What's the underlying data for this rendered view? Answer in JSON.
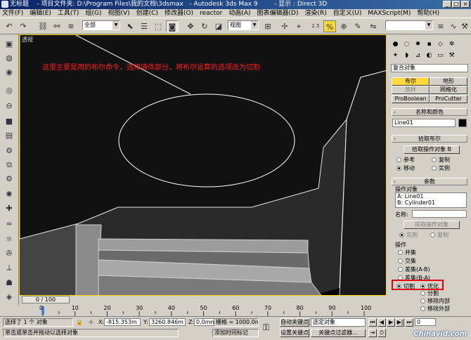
{
  "window": {
    "title_left": "无标题    - 项目文件夹: D:\\Program Files\\我的文档\\3dsmax   - Autodesk 3ds Max 9",
    "title_right": "- 显示 : Direct 3D"
  },
  "menu": [
    "文件(F)",
    "编辑(E)",
    "工具(T)",
    "组(G)",
    "视图(V)",
    "创建(C)",
    "修改器(O)",
    "reactor",
    "动画(A)",
    "图表编辑器(D)",
    "渲染(R)",
    "自定义(U)",
    "MAXScript(M)",
    "帮助(H)"
  ],
  "toolbar": {
    "selection_filter": "全部",
    "reference_coord": "视图",
    "named_selection": "",
    "angle_snap_label": "2.5"
  },
  "viewport": {
    "label": "透视",
    "annotation": "这里主要是用的布尔命令，选择墙体部分，将布尔运算的选项改为切割"
  },
  "command_panel": {
    "category": "复合对象",
    "buttons": {
      "boolean": "布尔",
      "shape_merge": "地形",
      "loft": "放样",
      "mesher": "网格化",
      "proboolean": "ProBoolean",
      "procutter": "ProCutter"
    },
    "name_color_header": "名称和颜色",
    "object_name": "Line01",
    "pick_boolean_header": "拾取布尔",
    "pick_operand_button": "拾取操作对象 B",
    "pick_options": {
      "reference": "参考",
      "copy": "复制",
      "move": "移动",
      "instance": "实例"
    },
    "params_header": "参数",
    "operands_label": "操作对象",
    "operands": [
      "A: Line01",
      "B: Cylinder01"
    ],
    "name_label": "名称:",
    "extract_button": "提取操作对象",
    "extract_options": {
      "instance": "实例",
      "copy": "复制"
    },
    "operation_label": "操作",
    "operations": {
      "union": "并集",
      "intersection": "交集",
      "sub_ab": "差集(A-B)",
      "sub_ba": "差集(B-A)",
      "cut": "切割",
      "refine": "优化",
      "split": "分割",
      "remove_inside": "移除内部",
      "remove_outside": "移除外部"
    }
  },
  "timeline": {
    "frame_display": "0 / 100",
    "ticks": [
      "0",
      "10",
      "20",
      "30",
      "40",
      "50",
      "60",
      "70",
      "80",
      "90",
      "100"
    ]
  },
  "status": {
    "selection": "选择了 1 个 对象",
    "prompt": "单击或单击并拖动以选择对象",
    "x_label": "X:",
    "x_value": "-815.353m",
    "y_label": "Y:",
    "y_value": "3260.846m",
    "z_label": "Z:",
    "z_value": "0.0mm",
    "grid": "栅格 = 1000.0mm",
    "add_time_tag": "添加时间标记",
    "auto_key": "自动关键点",
    "set_key": "设置关键点",
    "key_filter_dropdown": "选定对象",
    "key_filters": "关键点过滤器...",
    "frame": "0",
    "watermark": "Chinavid.com"
  }
}
